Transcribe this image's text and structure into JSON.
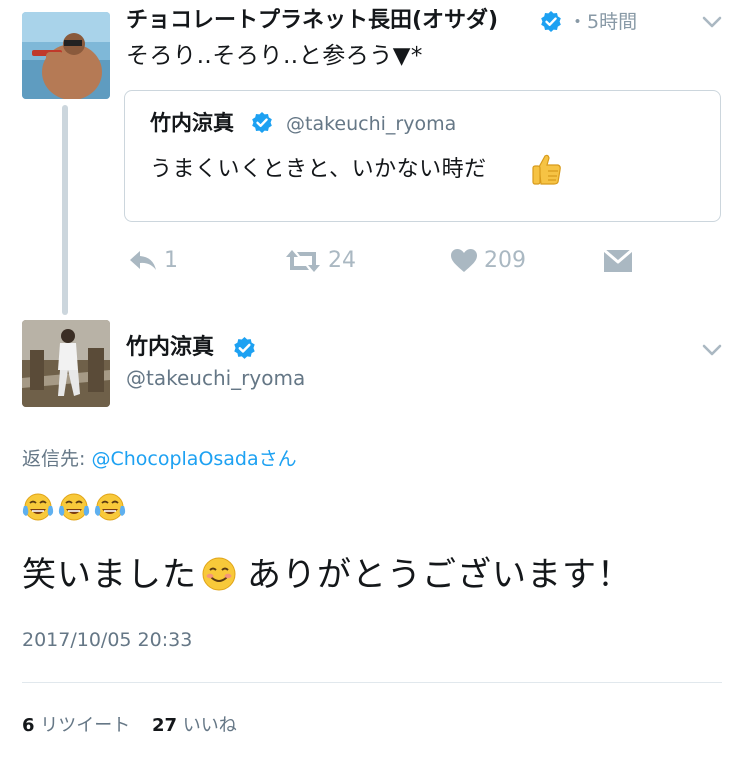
{
  "parent_tweet": {
    "display_name": "チョコレートプラネット長田(オサダ)",
    "time": "・5時間",
    "text": "そろり‥そろり‥と参ろう▼*",
    "quote": {
      "display_name": "竹内涼真",
      "handle": "@takeuchi_ryoma",
      "text": "うまくいくときと、いかない時だ",
      "emoji_icon": "thumbs-up"
    },
    "actions": {
      "reply_count": "1",
      "retweet_count": "24",
      "like_count": "209"
    }
  },
  "main_tweet": {
    "display_name": "竹内涼真",
    "handle": "@takeuchi_ryoma",
    "reply_prefix": "返信先: ",
    "reply_mention": "@ChocoplaOsada",
    "reply_suffix": "さん",
    "emoji_line": [
      "face-with-tears-of-joy",
      "face-with-tears-of-joy",
      "face-with-tears-of-joy"
    ],
    "text_part1": "笑いました",
    "text_emoji": "smiling-face",
    "text_part2": "ありがとうございます！",
    "timestamp": "2017/10/05 20:33",
    "stats": {
      "retweets_count": "6",
      "retweets_label": "リツイート",
      "likes_count": "27",
      "likes_label": "いいね"
    }
  },
  "colors": {
    "verified": "#1da1f2",
    "link": "#1da1f2",
    "muted": "#657786",
    "action_gray": "#aab8c2",
    "border": "#ccd6dd"
  }
}
